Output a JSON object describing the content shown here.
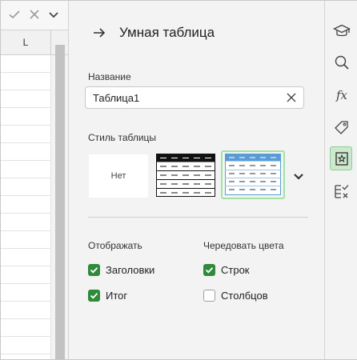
{
  "spreadsheet": {
    "column_header": "L",
    "formula_bar": {
      "confirm_icon": "check-icon",
      "cancel_icon": "close-icon",
      "dropdown_icon": "chevron-down-icon"
    }
  },
  "panel": {
    "back_icon": "arrow-right-icon",
    "title": "Умная таблица",
    "name_label": "Название",
    "name_value": "Таблица1",
    "clear_icon": "close-icon",
    "style_label": "Стиль таблицы",
    "styles": [
      {
        "id": "none",
        "label": "Нет"
      },
      {
        "id": "black",
        "label": ""
      },
      {
        "id": "blue",
        "label": "",
        "selected": true
      }
    ],
    "more_styles_icon": "chevron-down-icon",
    "display_label": "Отображать",
    "alternate_label": "Чередовать цвета",
    "options": {
      "headers": {
        "label": "Заголовки",
        "checked": true
      },
      "total": {
        "label": "Итог",
        "checked": true
      },
      "rows": {
        "label": "Строк",
        "checked": true
      },
      "columns": {
        "label": "Столбцов",
        "checked": false
      }
    }
  },
  "rail": {
    "items": [
      {
        "icon": "graduation-cap-icon"
      },
      {
        "icon": "search-icon"
      },
      {
        "icon": "function-icon",
        "text": "fx"
      },
      {
        "icon": "tag-icon"
      },
      {
        "icon": "smart-table-icon",
        "active": true
      },
      {
        "icon": "validation-icon"
      }
    ]
  },
  "colors": {
    "accent_green": "#2e8b3a",
    "selected_border": "#a6e0a9",
    "table_blue": "#5b9bd5"
  }
}
